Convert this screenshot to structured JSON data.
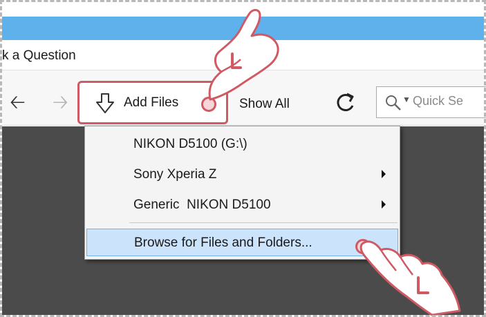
{
  "menubar": {
    "item": "k a Question"
  },
  "toolbar": {
    "add_files_label": "Add Files",
    "show_all_label": "Show All",
    "search_placeholder": "Quick Se"
  },
  "dropdown": {
    "items": [
      {
        "label": "NIKON D5100 (G:\\)",
        "submenu": false
      },
      {
        "label": "Sony Xperia Z",
        "submenu": true
      },
      {
        "label": "Generic  NIKON D5100",
        "submenu": true
      },
      {
        "label": "Browse for Files and Folders...",
        "submenu": false,
        "highlighted": true
      }
    ]
  },
  "annotations": {
    "tap_marker_letter": "L",
    "accent_color": "#cf5a64"
  },
  "colors": {
    "titlebar": "#5fb1ec",
    "content_bg": "#4b4b4b",
    "highlight": "#cce4fb"
  }
}
